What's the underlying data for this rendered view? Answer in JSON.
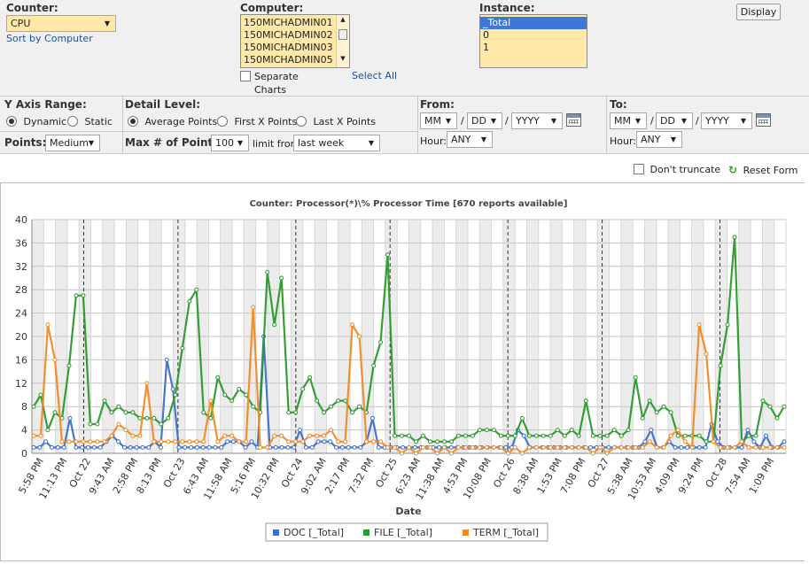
{
  "form": {
    "counter": {
      "label": "Counter:",
      "value": "CPU",
      "sort_link": "Sort by Computer"
    },
    "computer": {
      "label": "Computer:",
      "options": [
        "150MICHADMIN01",
        "150MICHADMIN02",
        "150MICHADMIN03",
        "150MICHADMIN05"
      ],
      "separate_label": "Separate",
      "charts_label": "Charts",
      "select_all": "Select All"
    },
    "instance": {
      "label": "Instance:",
      "options": [
        "_Total",
        "0",
        "1"
      ]
    },
    "display_button": "Display",
    "y_axis": {
      "label": "Y Axis Range:",
      "dynamic": "Dynamic",
      "static": "Static"
    },
    "points": {
      "label": "Points:",
      "value": "Medium"
    },
    "detail": {
      "label": "Detail Level:",
      "average": "Average Points",
      "first": "First X Points",
      "last": "Last X Points"
    },
    "max_points": {
      "label": "Max # of Points:",
      "value": "100",
      "limit_label": "limit from",
      "limit_value": "last week"
    },
    "from": {
      "label": "From:",
      "mm": "MM",
      "dd": "DD",
      "yyyy": "YYYY",
      "sep": "/",
      "hour_label": "Hour:",
      "hour_value": "ANY"
    },
    "to": {
      "label": "To:",
      "mm": "MM",
      "dd": "DD",
      "yyyy": "YYYY",
      "sep": "/",
      "hour_label": "Hour:",
      "hour_value": "ANY"
    },
    "dont_truncate": "Don't truncate",
    "reset_form": "Reset Form"
  },
  "chart_data": {
    "type": "line",
    "title": "Counter: Processor(*)\\% Processor Time [670 reports available]",
    "xlabel": "Date",
    "ylabel": "",
    "ylim": [
      0,
      40
    ],
    "yticks": [
      0,
      4,
      8,
      12,
      16,
      20,
      24,
      28,
      32,
      36,
      40
    ],
    "grid": true,
    "legend_position": "bottom",
    "x_tick_labels": [
      "5:58 PM",
      "11:13 PM",
      "Oct 22",
      "9:43 AM",
      "2:58 PM",
      "8:13 PM",
      "Oct 23",
      "6:43 AM",
      "11:58 AM",
      "5:16 PM",
      "10:32 PM",
      "Oct 24",
      "9:02 AM",
      "2:17 PM",
      "7:32 PM",
      "Oct 25",
      "6:23 AM",
      "11:38 AM",
      "4:53 PM",
      "10:08 PM",
      "Oct 26",
      "8:38 AM",
      "1:53 PM",
      "7:08 PM",
      "Oct 27",
      "5:38 AM",
      "10:53 AM",
      "4:09 PM",
      "9:24 PM",
      "Oct 28",
      "7:54 AM",
      "1:09 PM"
    ],
    "day_boundaries": [
      "Oct 22",
      "Oct 23",
      "Oct 24",
      "Oct 25",
      "Oct 26",
      "Oct 27",
      "Oct 28"
    ],
    "series": [
      {
        "name": "DOC [_Total]",
        "color": "#3d6fc8",
        "values": [
          1,
          1,
          2,
          1,
          1,
          1,
          6,
          1,
          1,
          1,
          1,
          1,
          2,
          3,
          2,
          1,
          1,
          1,
          1,
          1,
          2,
          1,
          16,
          11,
          1,
          1,
          1,
          1,
          1,
          1,
          1,
          1,
          2,
          2,
          2,
          1,
          2,
          1,
          20,
          1,
          1,
          1,
          1,
          1,
          4,
          1,
          1,
          2,
          2,
          2,
          1,
          1,
          1,
          1,
          1,
          2,
          6,
          1,
          1,
          1,
          1,
          1,
          1,
          1,
          1,
          1,
          1,
          1,
          1,
          1,
          1,
          1,
          1,
          1,
          1,
          1,
          1,
          1,
          1,
          1,
          4,
          3,
          1,
          1,
          1,
          1,
          1,
          1,
          1,
          1,
          1,
          1,
          1,
          1,
          1,
          1,
          1,
          1,
          1,
          1,
          1,
          2,
          4,
          1,
          1,
          2,
          1,
          1,
          1,
          1,
          1,
          1,
          5,
          2,
          1,
          1,
          1,
          1,
          4,
          2,
          1,
          3,
          1,
          1,
          2
        ]
      },
      {
        "name": "FILE [_Total]",
        "color": "#2a9a2a",
        "values": [
          8,
          10,
          4,
          7,
          6,
          15,
          27,
          27,
          5,
          5,
          9,
          7,
          8,
          7,
          7,
          6,
          6,
          6,
          5,
          6,
          10,
          18,
          26,
          28,
          7,
          6,
          13,
          10,
          9,
          11,
          10,
          8,
          7,
          31,
          22,
          30,
          7,
          7,
          11,
          13,
          9,
          7,
          8,
          9,
          9,
          7,
          8,
          7,
          15,
          19,
          34,
          3,
          3,
          3,
          2,
          3,
          2,
          2,
          2,
          2,
          3,
          3,
          3,
          4,
          4,
          4,
          3,
          3,
          3,
          6,
          3,
          3,
          3,
          3,
          4,
          3,
          4,
          3,
          9,
          3,
          3,
          3,
          4,
          3,
          4,
          13,
          6,
          9,
          7,
          8,
          7,
          3,
          3,
          3,
          3,
          2,
          2,
          15,
          22,
          37,
          2,
          3,
          3,
          9,
          8,
          6,
          8
        ]
      },
      {
        "name": "TERM [_Total]",
        "color": "#f08a24",
        "values": [
          3,
          3,
          22,
          16,
          2,
          2,
          2,
          2,
          2,
          2,
          2,
          3,
          5,
          4,
          3,
          3,
          12,
          2,
          2,
          2,
          2,
          2,
          2,
          2,
          2,
          9,
          2,
          3,
          3,
          2,
          2,
          25,
          1,
          1,
          3,
          3,
          2,
          2,
          2,
          3,
          3,
          3,
          4,
          2,
          2,
          22,
          20,
          2,
          2,
          2,
          1,
          1,
          0,
          1,
          0,
          1,
          1,
          0,
          1,
          0,
          1,
          1,
          1,
          1,
          1,
          1,
          1,
          0,
          1,
          0,
          1,
          1,
          1,
          1,
          1,
          1,
          1,
          1,
          1,
          0,
          1,
          0,
          1,
          1,
          1,
          1,
          1,
          2,
          1,
          1,
          3,
          4,
          2,
          1,
          22,
          17,
          2,
          1,
          1,
          1,
          2,
          1,
          1,
          1,
          1,
          1,
          1
        ]
      }
    ]
  }
}
